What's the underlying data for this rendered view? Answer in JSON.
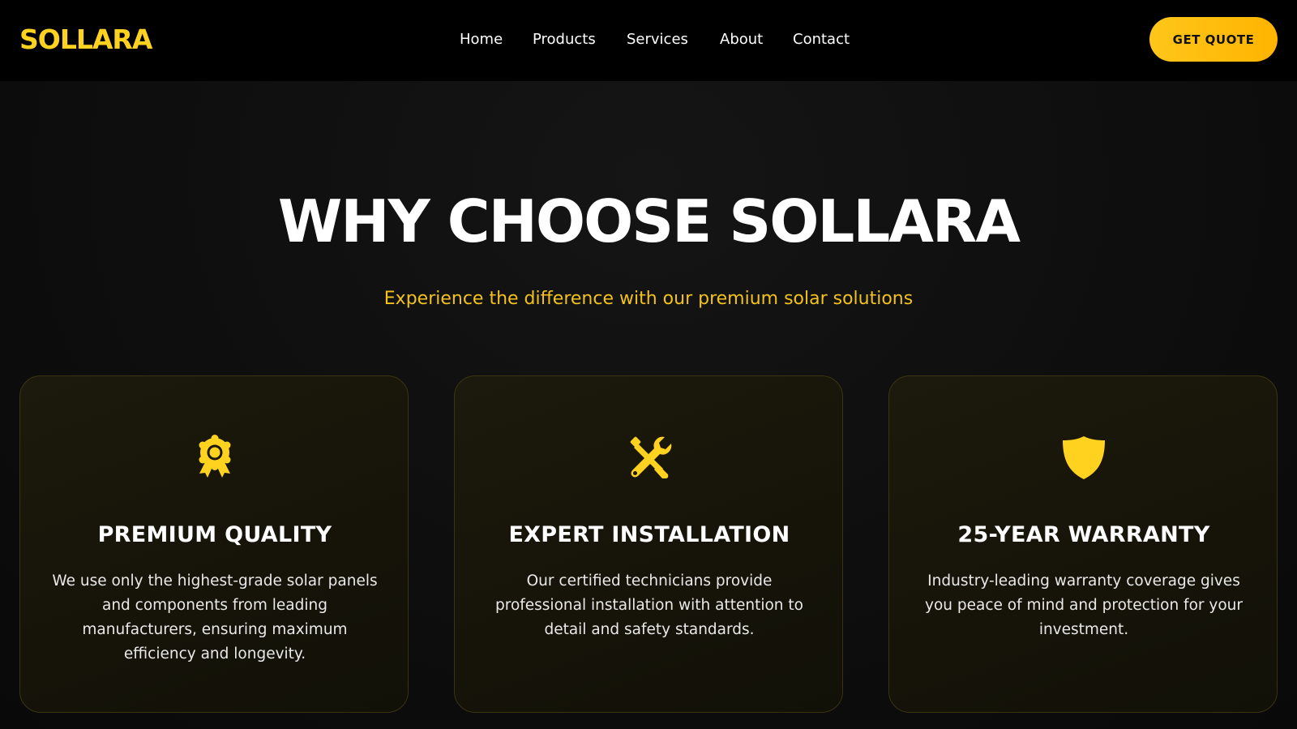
{
  "brand": {
    "logo": "SOLLARA",
    "accent": "#ffd21f"
  },
  "nav": {
    "links": [
      "Home",
      "Products",
      "Services",
      "About",
      "Contact"
    ],
    "cta_label": "GET QUOTE"
  },
  "hero": {
    "heading": "WHY CHOOSE SOLLARA",
    "subheading": "Experience the difference with our premium solar solutions"
  },
  "features": [
    {
      "icon": "award-icon",
      "title": "PREMIUM QUALITY",
      "description": "We use only the highest-grade solar panels and components from leading manufacturers, ensuring maximum efficiency and longevity."
    },
    {
      "icon": "tools-icon",
      "title": "EXPERT INSTALLATION",
      "description": "Our certified technicians provide professional installation with attention to detail and safety standards."
    },
    {
      "icon": "shield-icon",
      "title": "25-YEAR WARRANTY",
      "description": "Industry-leading warranty coverage gives you peace of mind and protection for your investment."
    }
  ]
}
